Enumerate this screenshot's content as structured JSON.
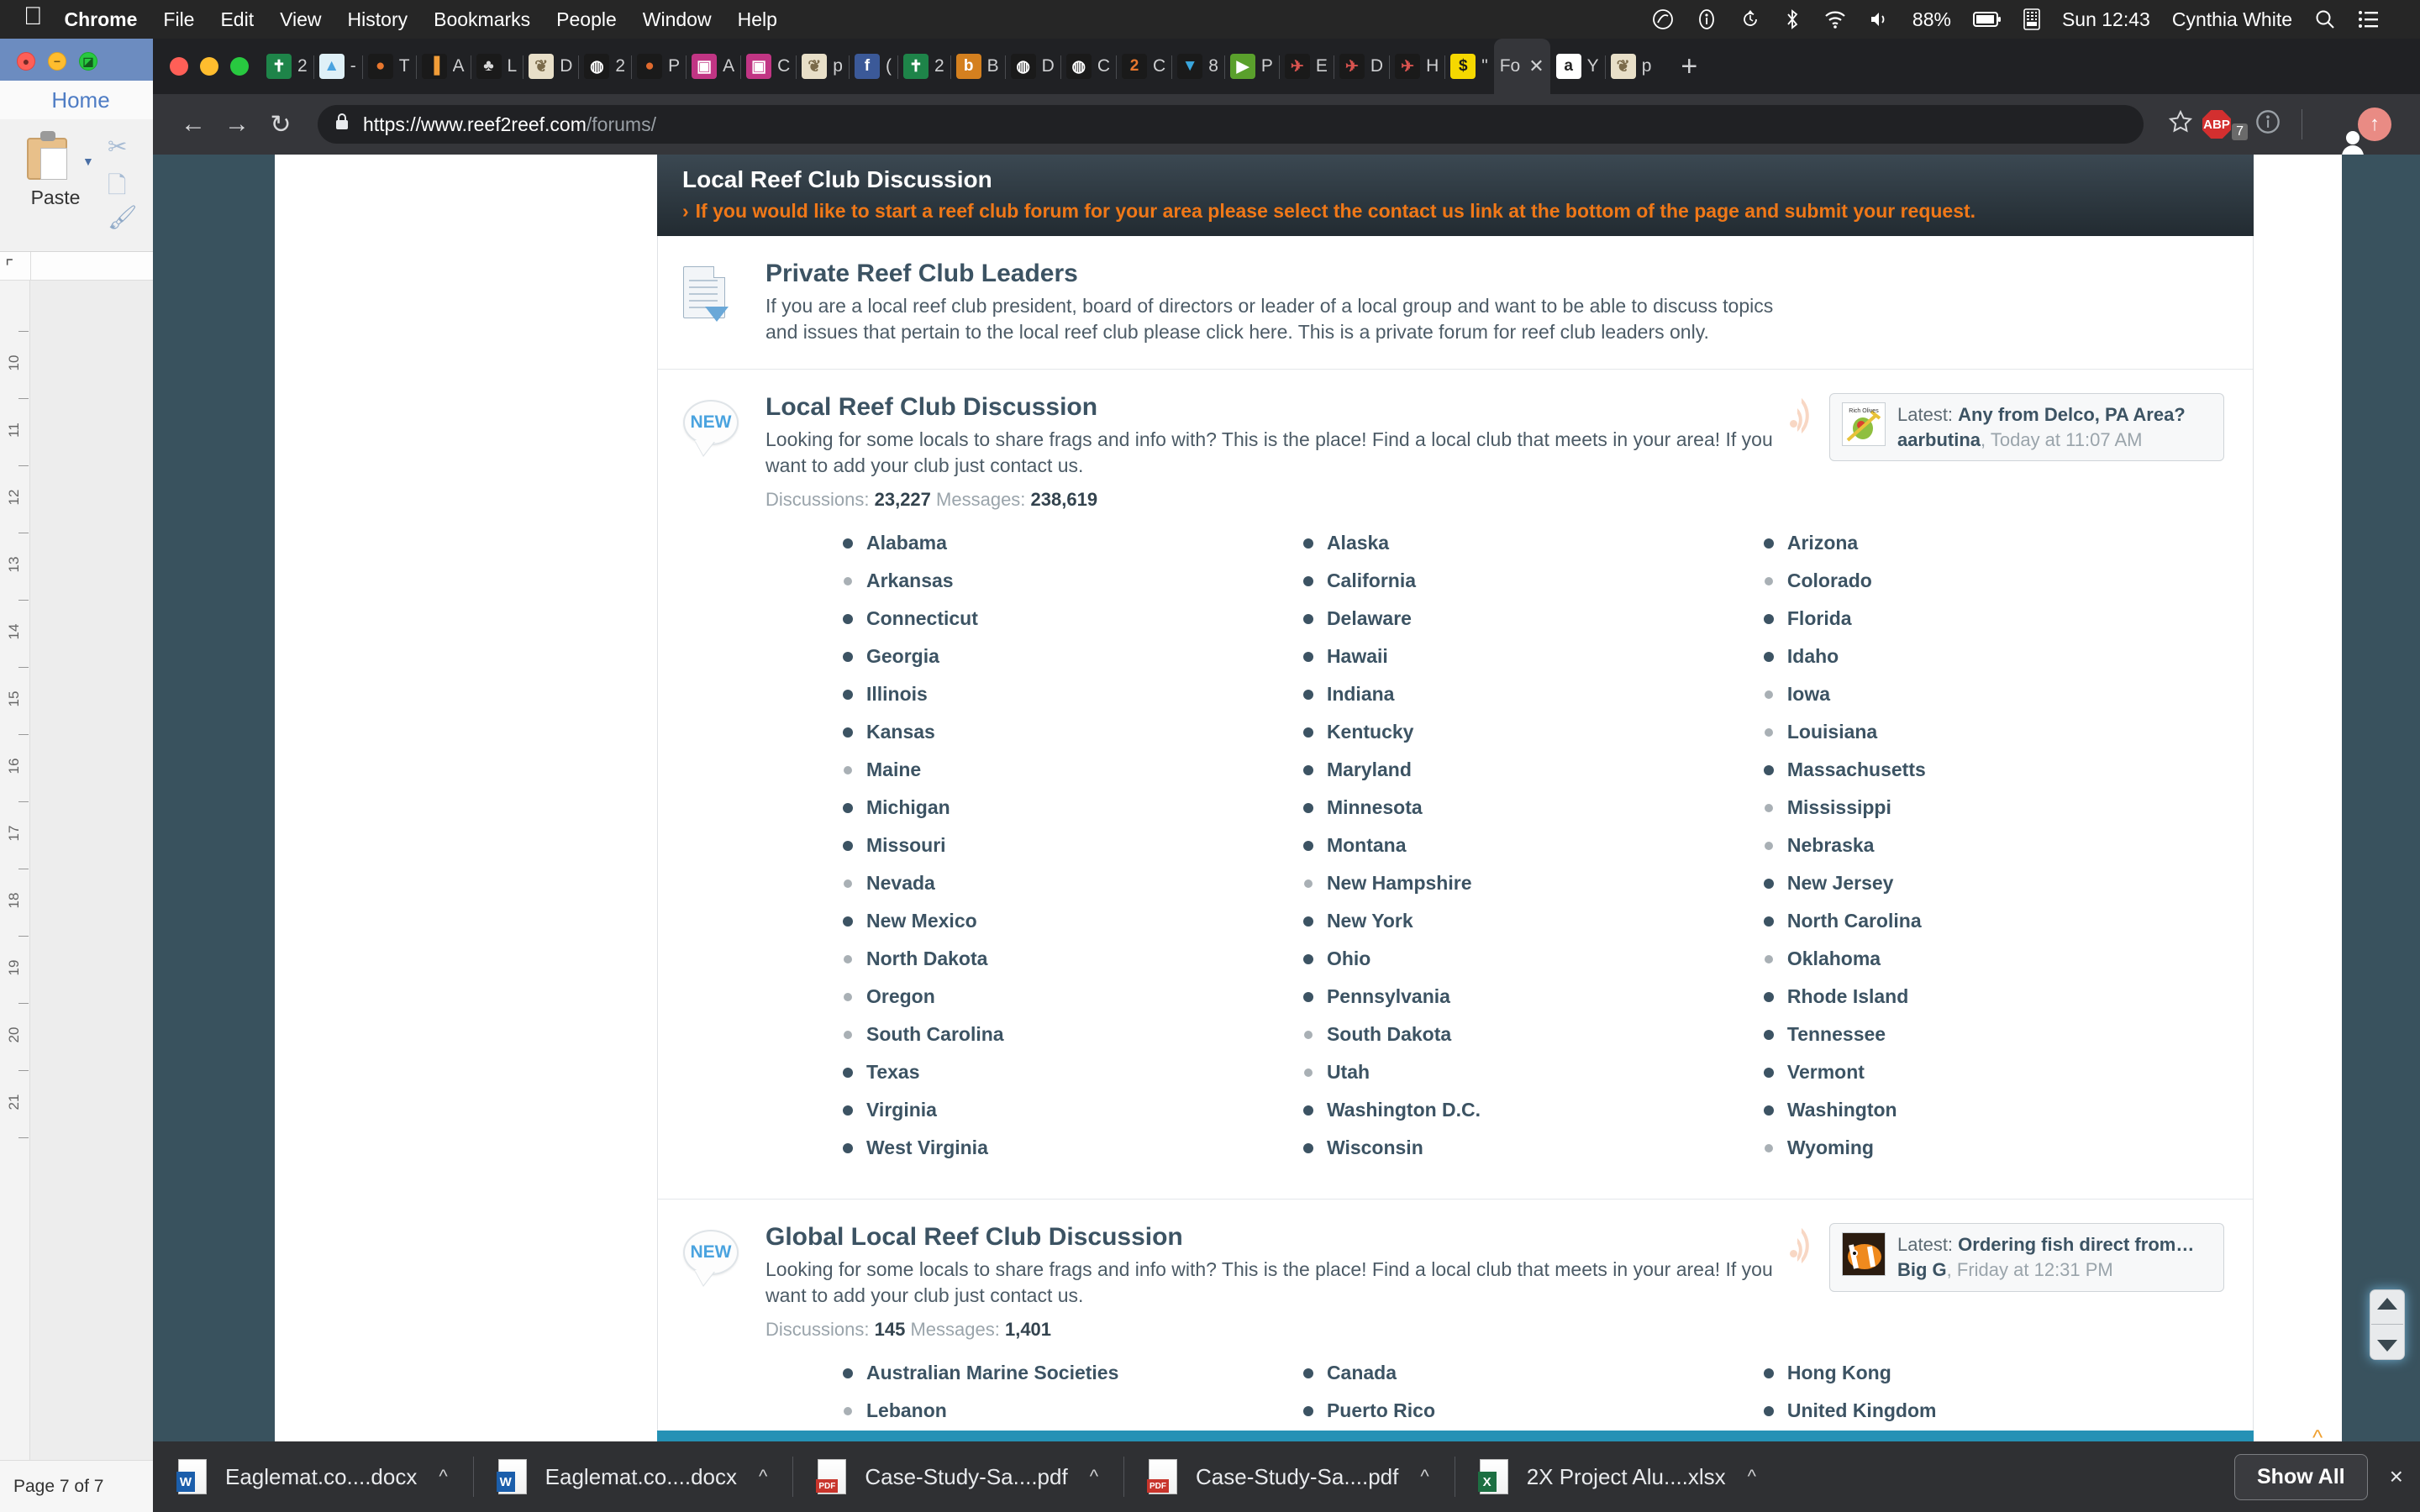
{
  "menubar": {
    "apple_icon": "apple-icon",
    "items": [
      "Chrome",
      "File",
      "Edit",
      "View",
      "History",
      "Bookmarks",
      "People",
      "Window",
      "Help"
    ],
    "status_icons": [
      "nfc-icon",
      "info-circle-icon",
      "time-machine-icon",
      "bluetooth-icon",
      "wifi-icon",
      "volume-icon"
    ],
    "battery": "88%",
    "input_menu_icon": "keyboard-icon",
    "clock": "Sun 12:43",
    "user": "Cynthia White",
    "search_icon": "search-icon",
    "control_center_icon": "control-center-icon"
  },
  "word_window": {
    "tab": "Home",
    "paste_label": "Paste",
    "ruler_numbers": [
      "10",
      "11",
      "12",
      "13",
      "14",
      "15",
      "16",
      "17",
      "18",
      "19",
      "20",
      "21"
    ],
    "status": "Page 7 of 7"
  },
  "browser": {
    "tabs": [
      {
        "fav": "bible-icon",
        "label": "2",
        "bg": "#1e8449",
        "glyph": "✝",
        "color": "#ffffff"
      },
      {
        "fav": "evernote-icon",
        "label": "-",
        "bg": "#dff0f7",
        "glyph": "▲",
        "color": "#4aa3df"
      },
      {
        "fav": "tumblr-icon",
        "label": "T",
        "bg": "#1a1a1a",
        "glyph": "●",
        "color": "#e8772e"
      },
      {
        "fav": "analytics-icon",
        "label": "A",
        "bg": "#1a1a1a",
        "glyph": "▐",
        "color": "#f29d38"
      },
      {
        "fav": "photo-icon",
        "label": "L",
        "bg": "#1a1a1a",
        "glyph": "♣",
        "color": "#d8d8d8"
      },
      {
        "fav": "image-icon",
        "label": "D",
        "bg": "#e8dfc8",
        "glyph": "❦",
        "color": "#7a6a4a"
      },
      {
        "fav": "globe-icon",
        "label": "2",
        "bg": "#1a1a1a",
        "glyph": "◍",
        "color": "#ffffff"
      },
      {
        "fav": "monkey-icon",
        "label": "P",
        "bg": "#1a1a1a",
        "glyph": "●",
        "color": "#e06a2e"
      },
      {
        "fav": "instagram-icon",
        "label": "A",
        "bg": "#c13584",
        "glyph": "▣",
        "color": "#ffffff"
      },
      {
        "fav": "instagram-icon",
        "label": "C",
        "bg": "#c13584",
        "glyph": "▣",
        "color": "#ffffff"
      },
      {
        "fav": "image-icon",
        "label": "p",
        "bg": "#e8dfc8",
        "glyph": "❦",
        "color": "#7a6a4a"
      },
      {
        "fav": "facebook-icon",
        "label": "(",
        "bg": "#3b5998",
        "glyph": "f",
        "color": "#ffffff"
      },
      {
        "fav": "bible-icon",
        "label": "2",
        "bg": "#1e8449",
        "glyph": "✝",
        "color": "#ffffff"
      },
      {
        "fav": "blogger-icon",
        "label": "B",
        "bg": "#d4801f",
        "glyph": "b",
        "color": "#ffffff"
      },
      {
        "fav": "globe-icon",
        "label": "D",
        "bg": "#1a1a1a",
        "glyph": "◍",
        "color": "#ffffff"
      },
      {
        "fav": "globe-icon",
        "label": "C",
        "bg": "#1a1a1a",
        "glyph": "◍",
        "color": "#ffffff"
      },
      {
        "fav": "two-icon",
        "label": "C",
        "bg": "#1a1a1a",
        "glyph": "2",
        "color": "#e8772e"
      },
      {
        "fav": "vimeo-icon",
        "label": "8",
        "bg": "#1a1a1a",
        "glyph": "▼",
        "color": "#3aa6dd"
      },
      {
        "fav": "play-icon",
        "label": "P",
        "bg": "#5aa02c",
        "glyph": "▶",
        "color": "#ffffff"
      },
      {
        "fav": "rocket-icon",
        "label": "E",
        "bg": "#1a1a1a",
        "glyph": "✈",
        "color": "#d9534f"
      },
      {
        "fav": "rocket-icon",
        "label": "D",
        "bg": "#1a1a1a",
        "glyph": "✈",
        "color": "#d9534f"
      },
      {
        "fav": "rocket-icon",
        "label": "H",
        "bg": "#1a1a1a",
        "glyph": "✈",
        "color": "#d9534f"
      },
      {
        "fav": "dollar-icon",
        "label": "\"",
        "bg": "#f5d800",
        "glyph": "$",
        "color": "#1a1a1a"
      },
      {
        "fav": "forum-icon",
        "label": "Fo",
        "bg": "#35363a",
        "glyph": "",
        "color": "#cfd0d2",
        "active": true
      },
      {
        "fav": "amazon-icon",
        "label": "Y",
        "bg": "#ffffff",
        "glyph": "a",
        "color": "#222222"
      },
      {
        "fav": "image-icon",
        "label": "p",
        "bg": "#e8dfc8",
        "glyph": "❦",
        "color": "#7a6a4a"
      }
    ],
    "active_tab_close": "close-icon",
    "new_tab": "+",
    "nav": {
      "back": "←",
      "forward": "→",
      "reload": "↻"
    },
    "omnibox": {
      "lock_icon": "lock-icon",
      "host": "https://www.reef2reef.com",
      "path": "/forums/"
    },
    "toolbar_icons": {
      "bookmark_star": "star-icon",
      "adblock": "ABP",
      "adblock_count": "7",
      "extension": "info-circle-icon",
      "profile": "avatar-icon",
      "update": "update-arrow-icon"
    }
  },
  "page": {
    "node_header": {
      "title": "Local Reef Club Discussion",
      "notice_chevron": "›",
      "notice": "If you would like to start a reef club forum for your area please select the contact us link at the bottom of the page and submit your request."
    },
    "forums": [
      {
        "icon": "document-icon",
        "badge": null,
        "title": "Private Reef Club Leaders",
        "description": "If you are a local reef club president, board of directors or leader of a local group and want to be able to discuss topics and issues that pertain to the local reef club please click here. This is a private forum for reef club leaders only.",
        "stats": null,
        "latest": null,
        "subforums": []
      },
      {
        "icon": "new-bubble-icon",
        "badge": "NEW",
        "title": "Local Reef Club Discussion",
        "description": "Looking for some locals to share frags and info with? This is the place! Find a local club that meets in your area! If you want to add your club just contact us.",
        "stats": {
          "discussions_label": "Discussions:",
          "discussions": "23,227",
          "messages_label": "Messages:",
          "messages": "238,619"
        },
        "latest": {
          "rss_icon": "rss-icon",
          "avatar": "olive-avatar",
          "prefix": "Latest:",
          "thread": "Any from Delco, PA Area?",
          "user": "aarbutina",
          "date": "Today at 11:07 AM"
        },
        "subforums": [
          {
            "name": "Alabama",
            "state": "unread"
          },
          {
            "name": "Alaska",
            "state": "unread"
          },
          {
            "name": "Arizona",
            "state": "unread"
          },
          {
            "name": "Arkansas",
            "state": "read"
          },
          {
            "name": "California",
            "state": "unread"
          },
          {
            "name": "Colorado",
            "state": "read"
          },
          {
            "name": "Connecticut",
            "state": "unread"
          },
          {
            "name": "Delaware",
            "state": "unread"
          },
          {
            "name": "Florida",
            "state": "unread"
          },
          {
            "name": "Georgia",
            "state": "unread"
          },
          {
            "name": "Hawaii",
            "state": "unread"
          },
          {
            "name": "Idaho",
            "state": "unread"
          },
          {
            "name": "Illinois",
            "state": "unread"
          },
          {
            "name": "Indiana",
            "state": "unread"
          },
          {
            "name": "Iowa",
            "state": "read"
          },
          {
            "name": "Kansas",
            "state": "unread"
          },
          {
            "name": "Kentucky",
            "state": "unread"
          },
          {
            "name": "Louisiana",
            "state": "read"
          },
          {
            "name": "Maine",
            "state": "read"
          },
          {
            "name": "Maryland",
            "state": "unread"
          },
          {
            "name": "Massachusetts",
            "state": "unread"
          },
          {
            "name": "Michigan",
            "state": "unread"
          },
          {
            "name": "Minnesota",
            "state": "unread"
          },
          {
            "name": "Mississippi",
            "state": "read"
          },
          {
            "name": "Missouri",
            "state": "unread"
          },
          {
            "name": "Montana",
            "state": "unread"
          },
          {
            "name": "Nebraska",
            "state": "read"
          },
          {
            "name": "Nevada",
            "state": "read"
          },
          {
            "name": "New Hampshire",
            "state": "read"
          },
          {
            "name": "New Jersey",
            "state": "unread"
          },
          {
            "name": "New Mexico",
            "state": "unread"
          },
          {
            "name": "New York",
            "state": "unread"
          },
          {
            "name": "North Carolina",
            "state": "unread"
          },
          {
            "name": "North Dakota",
            "state": "read"
          },
          {
            "name": "Ohio",
            "state": "unread"
          },
          {
            "name": "Oklahoma",
            "state": "read"
          },
          {
            "name": "Oregon",
            "state": "read"
          },
          {
            "name": "Pennsylvania",
            "state": "unread"
          },
          {
            "name": "Rhode Island",
            "state": "unread"
          },
          {
            "name": "South Carolina",
            "state": "read"
          },
          {
            "name": "South Dakota",
            "state": "read"
          },
          {
            "name": "Tennessee",
            "state": "unread"
          },
          {
            "name": "Texas",
            "state": "unread"
          },
          {
            "name": "Utah",
            "state": "read"
          },
          {
            "name": "Vermont",
            "state": "unread"
          },
          {
            "name": "Virginia",
            "state": "unread"
          },
          {
            "name": "Washington D.C.",
            "state": "unread"
          },
          {
            "name": "Washington",
            "state": "unread"
          },
          {
            "name": "West Virginia",
            "state": "unread"
          },
          {
            "name": "Wisconsin",
            "state": "unread"
          },
          {
            "name": "Wyoming",
            "state": "read"
          }
        ]
      },
      {
        "icon": "new-bubble-icon",
        "badge": "NEW",
        "title": "Global Local Reef Club Discussion",
        "description": "Looking for some locals to share frags and info with? This is the place! Find a local club that meets in your area! If you want to add your club just contact us.",
        "stats": {
          "discussions_label": "Discussions:",
          "discussions": "145",
          "messages_label": "Messages:",
          "messages": "1,401"
        },
        "latest": {
          "rss_icon": "rss-icon",
          "avatar": "clownfish-avatar",
          "prefix": "Latest:",
          "thread": "Ordering fish direct from…",
          "user": "Big G",
          "date": "Friday at 12:31 PM"
        },
        "subforums": [
          {
            "name": "Australian Marine Societies",
            "state": "unread"
          },
          {
            "name": "Canada",
            "state": "unread"
          },
          {
            "name": "Hong Kong",
            "state": "unread"
          },
          {
            "name": "Lebanon",
            "state": "read"
          },
          {
            "name": "Puerto Rico",
            "state": "unread"
          },
          {
            "name": "United Kingdom",
            "state": "unread"
          }
        ]
      }
    ],
    "scroll_widget": {
      "up": "scroll-up-arrow",
      "down": "scroll-down-arrow"
    }
  },
  "taskbar": {
    "items": [
      {
        "icon": "word-file-icon",
        "label": "Eaglemat.co....docx",
        "caret": "^"
      },
      {
        "icon": "word-file-icon",
        "label": "Eaglemat.co....docx",
        "caret": "^"
      },
      {
        "icon": "pdf-file-icon",
        "label": "Case-Study-Sa....pdf",
        "caret": "^"
      },
      {
        "icon": "pdf-file-icon",
        "label": "Case-Study-Sa....pdf",
        "caret": "^"
      },
      {
        "icon": "excel-file-icon",
        "label": "2X Project Alu....xlsx",
        "caret": "^"
      }
    ],
    "show_all": "Show All",
    "close_icon": "×"
  }
}
